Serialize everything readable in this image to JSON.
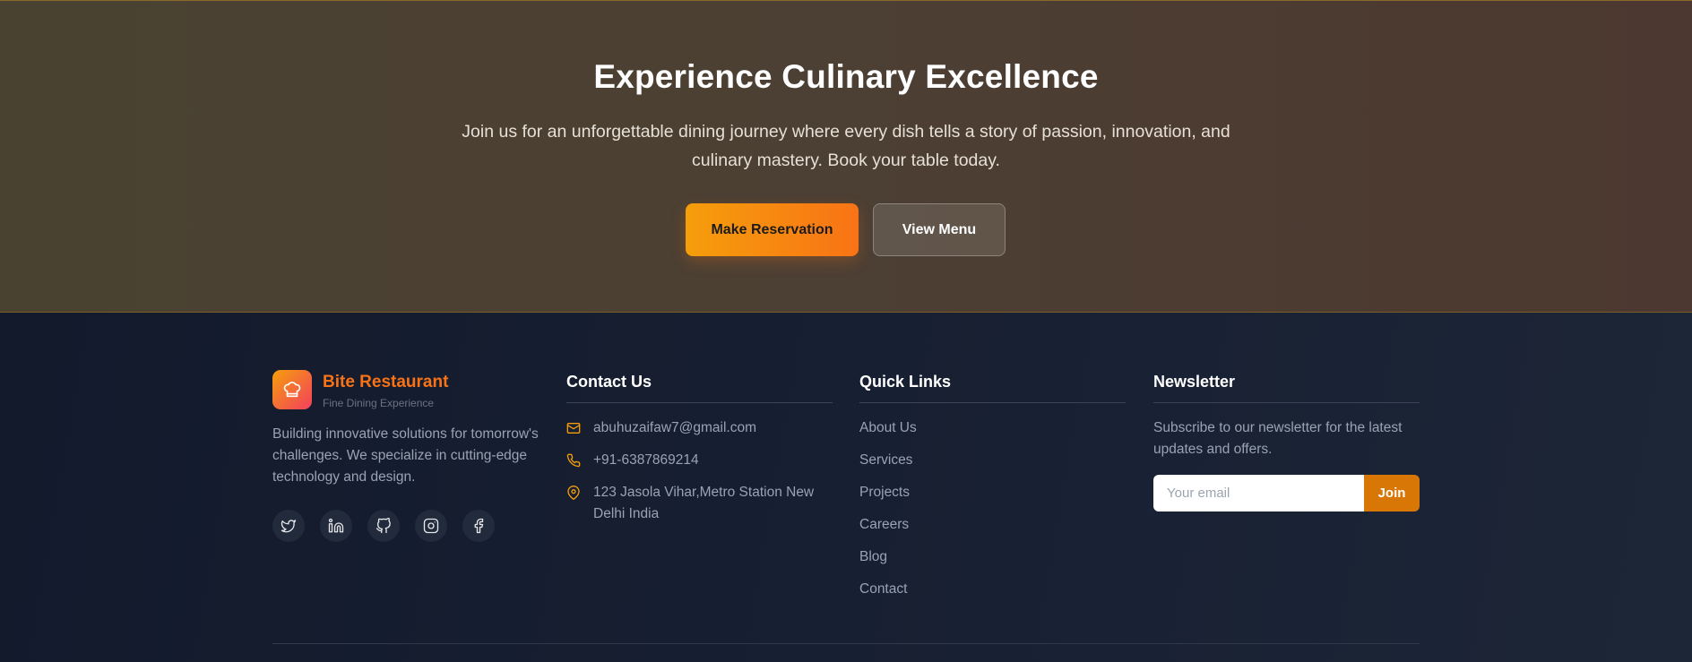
{
  "cta": {
    "title": "Experience Culinary Excellence",
    "description": "Join us for an unforgettable dining journey where every dish tells a story of passion, innovation, and culinary mastery. Book your table today.",
    "primary_button": "Make Reservation",
    "secondary_button": "View Menu"
  },
  "brand": {
    "name": "Bite Restaurant",
    "tagline": "Fine Dining Experience",
    "description": "Building innovative solutions for tomorrow's challenges. We specialize in cutting-edge technology and design.",
    "icon": "chef-hat-icon"
  },
  "socials": [
    {
      "icon": "twitter-icon"
    },
    {
      "icon": "linkedin-icon"
    },
    {
      "icon": "github-icon"
    },
    {
      "icon": "instagram-icon"
    },
    {
      "icon": "facebook-icon"
    }
  ],
  "contact": {
    "title": "Contact Us",
    "email": "abuhuzaifaw7@gmail.com",
    "phone": "+91-6387869214",
    "address": "123 Jasola Vihar,Metro Station New Delhi India"
  },
  "quick_links": {
    "title": "Quick Links",
    "items": [
      "About Us",
      "Services",
      "Projects",
      "Careers",
      "Blog",
      "Contact"
    ]
  },
  "newsletter": {
    "title": "Newsletter",
    "description": "Subscribe to our newsletter for the latest updates and offers.",
    "placeholder": "Your email",
    "button": "Join"
  },
  "colors": {
    "accent": "#f97316",
    "accent_amber": "#f59e0b",
    "join_button": "#d97706",
    "footer_bg": "#151c2e"
  }
}
